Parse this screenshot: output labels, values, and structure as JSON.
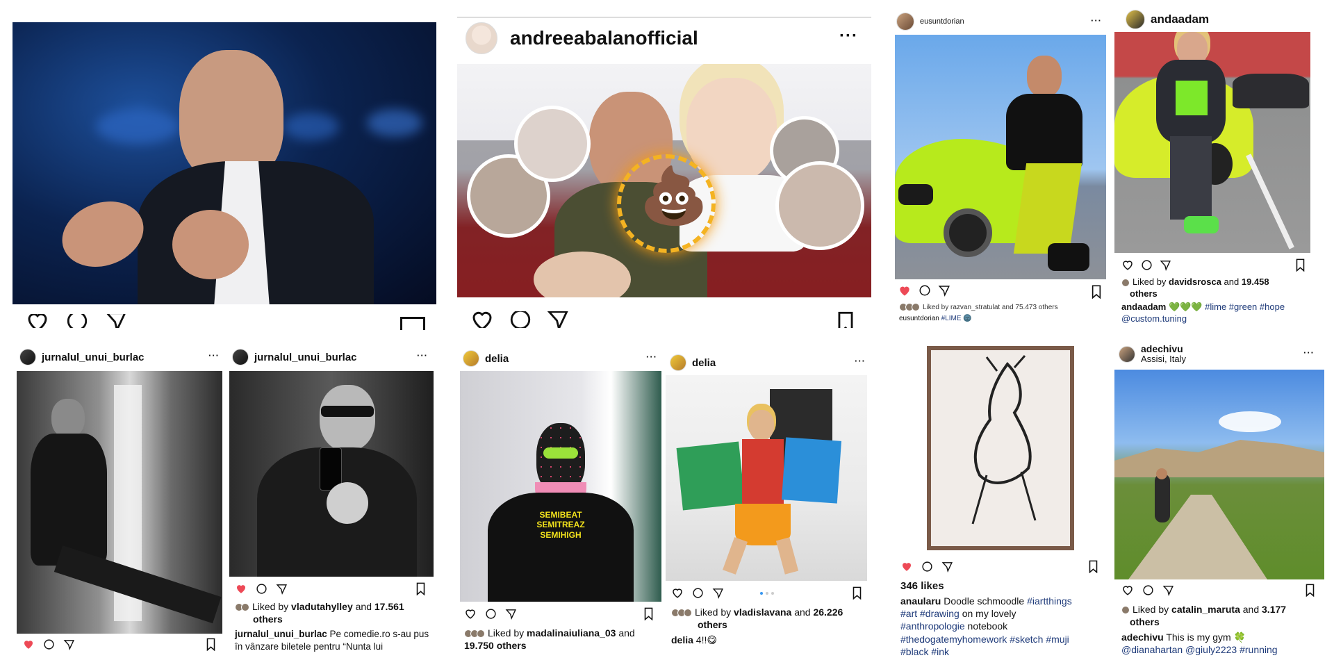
{
  "posts": {
    "p1": {},
    "p2": {
      "username": "andreeabalanofficial"
    },
    "p3": {
      "username": "eusuntdorian",
      "liked_prefix": "Liked by",
      "liker": "razvan_stratulat",
      "liked_suffix": "and 75.473 others",
      "caption_user": "eusuntdorian",
      "caption_tag": "#LIME",
      "caption_emoji": "🌚"
    },
    "p4": {
      "username": "andaadam",
      "liked_prefix": "Liked by",
      "liker": "davidsrosca",
      "liked_mid": "and",
      "liked_count": "19.458",
      "liked_others": "others",
      "caption_user": "andaadam",
      "caption_emoji": "💚💚💚",
      "caption_tags": "#lime #green #hope",
      "caption_mention": "@custom.tuning"
    },
    "p5": {
      "username": "jurnalul_unui_burlac"
    },
    "p6": {
      "username": "jurnalul_unui_burlac",
      "liked_prefix": "Liked by",
      "liker": "vladutahylley",
      "liked_mid": "and",
      "liked_count": "17.561",
      "liked_others": "others",
      "caption_user": "jurnalul_unui_burlac",
      "caption_text": "Pe comedie.ro s-au pus în vânzare biletele pentru “Nunta lui"
    },
    "p7": {
      "username": "delia",
      "liked_prefix": "Liked by",
      "liker": "madalinaiuliana_03",
      "liked_mid": "and",
      "liked_count": "19.750 others",
      "shirt_text": "SEMIBEAT SEMITREAZ SEMIHIGH"
    },
    "p8": {
      "username": "delia",
      "liked_prefix": "Liked by",
      "liker": "vladislavana",
      "liked_mid": "and",
      "liked_count": "26.226",
      "liked_others": "others",
      "caption_user": "delia",
      "caption_text": "4!!",
      "caption_emoji": "😋"
    },
    "p9": {
      "likes": "346 likes",
      "caption_user": "anaularu",
      "caption_text": "Doodle schmoodle",
      "caption_tag1": "#iartthings",
      "caption_tag2": "#art #drawing",
      "caption_text2": "on my lovely",
      "caption_tag3": "#anthropologie",
      "caption_text3": "notebook",
      "caption_tag4": "#thedogatemyhomework #sketch #muji",
      "caption_tag5": "#black #ink"
    },
    "p10": {
      "username": "adechivu",
      "location": "Assisi, Italy",
      "liked_prefix": "Liked by",
      "liker": "catalin_maruta",
      "liked_mid": "and",
      "liked_count": "3.177",
      "liked_others": "others",
      "caption_user": "adechivu",
      "caption_text": "This is my gym",
      "caption_emoji": "🍀",
      "caption_mentions": "@dianahartan @giuly2223",
      "caption_tag": "#running"
    }
  },
  "icons": {
    "heart": "heart-icon",
    "comment": "comment-icon",
    "share": "share-icon",
    "bookmark": "bookmark-icon",
    "more": "more-options-icon"
  },
  "colors": {
    "like_red": "#ed4956",
    "tag_blue": "#1f3b7a",
    "lime": "#b6e61a"
  },
  "more_label": "···"
}
